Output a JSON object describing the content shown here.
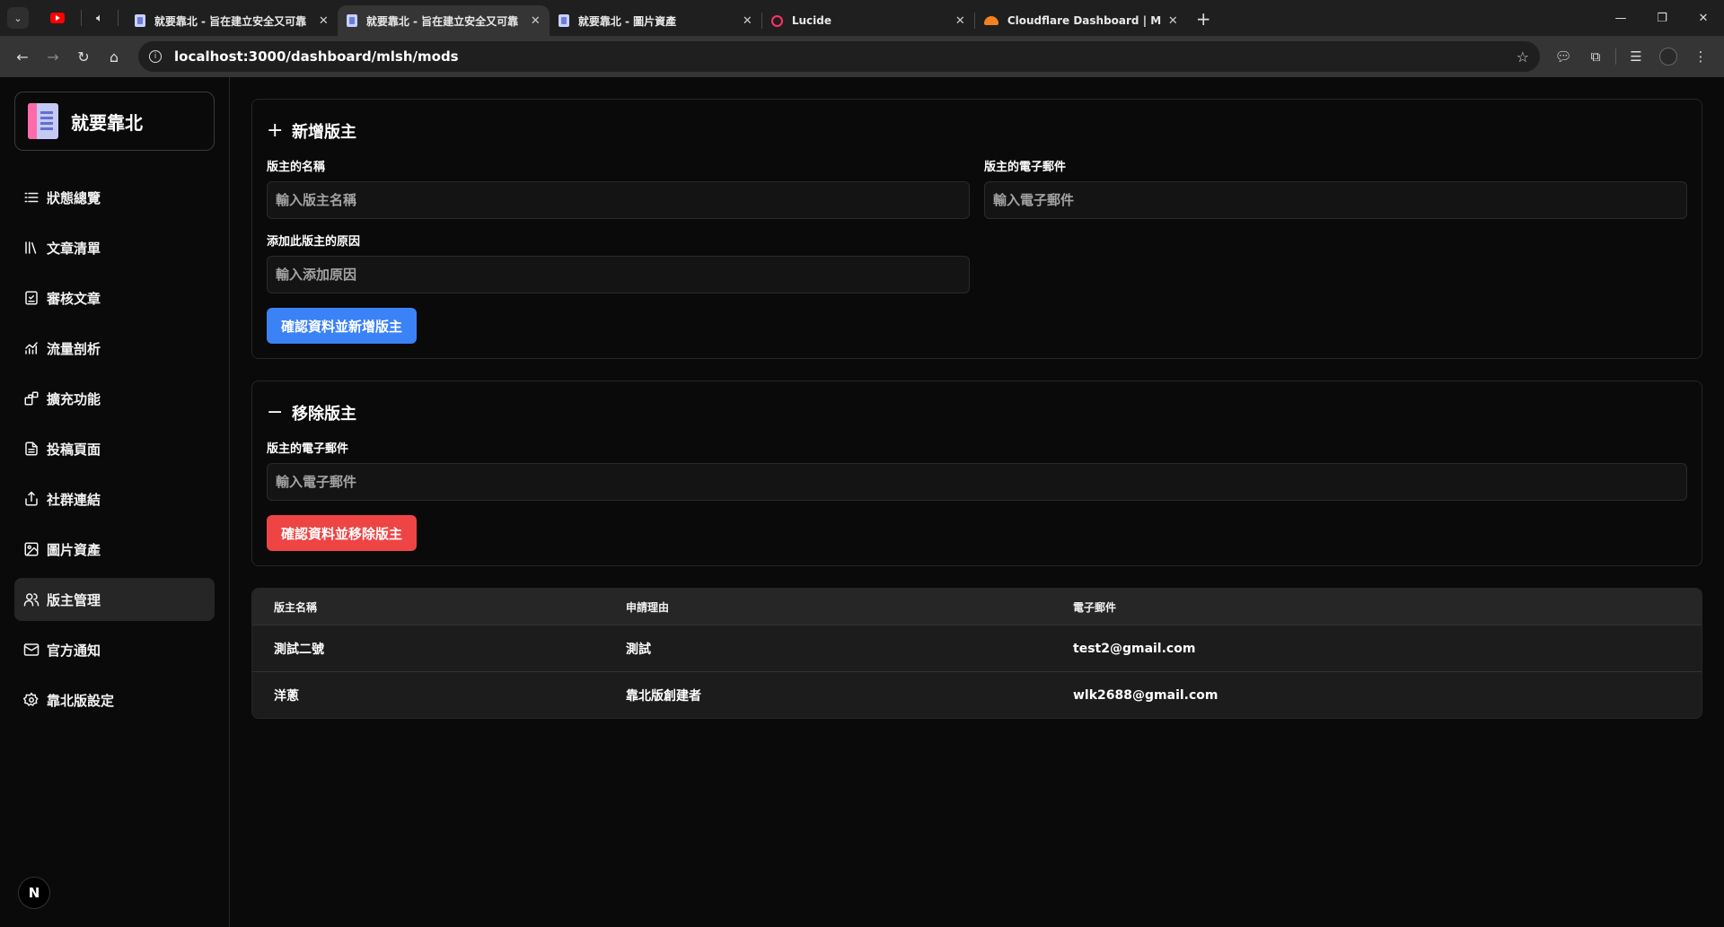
{
  "browser": {
    "tabs": [
      {
        "title": "就要靠北 - 旨在建立安全又可靠",
        "favicon": "app-icon",
        "active": false
      },
      {
        "title": "就要靠北 - 旨在建立安全又可靠",
        "favicon": "app-icon",
        "active": true
      },
      {
        "title": "就要靠北 - 圖片資產",
        "favicon": "app-icon",
        "active": false
      },
      {
        "title": "Lucide",
        "favicon": "lucide-icon",
        "active": false
      },
      {
        "title": "Cloudflare Dashboard | Ma",
        "favicon": "cloudflare-icon",
        "active": false
      }
    ],
    "url": "localhost:3000/dashboard/mlsh/mods"
  },
  "sidebar": {
    "brand": "就要靠北",
    "items": [
      {
        "label": "狀態總覽",
        "icon": "list-icon"
      },
      {
        "label": "文章清單",
        "icon": "library-icon"
      },
      {
        "label": "審核文章",
        "icon": "check-square-icon"
      },
      {
        "label": "流量剖析",
        "icon": "chart-icon"
      },
      {
        "label": "擴充功能",
        "icon": "blocks-icon"
      },
      {
        "label": "投稿頁面",
        "icon": "file-text-icon"
      },
      {
        "label": "社群連結",
        "icon": "share-icon"
      },
      {
        "label": "圖片資產",
        "icon": "image-icon"
      },
      {
        "label": "版主管理",
        "icon": "users-icon",
        "active": true
      },
      {
        "label": "官方通知",
        "icon": "mail-icon"
      },
      {
        "label": "靠北版設定",
        "icon": "settings-icon"
      }
    ],
    "badge": "N"
  },
  "add_mod": {
    "title": "新增版主",
    "name_label": "版主的名稱",
    "name_placeholder": "輸入版主名稱",
    "email_label": "版主的電子郵件",
    "email_placeholder": "輸入電子郵件",
    "reason_label": "添加此版主的原因",
    "reason_placeholder": "輸入添加原因",
    "submit": "確認資料並新增版主"
  },
  "remove_mod": {
    "title": "移除版主",
    "email_label": "版主的電子郵件",
    "email_placeholder": "輸入電子郵件",
    "submit": "確認資料並移除版主"
  },
  "table": {
    "headers": [
      "版主名稱",
      "申請理由",
      "電子郵件"
    ],
    "rows": [
      [
        "測試二號",
        "測試",
        "test2@gmail.com"
      ],
      [
        "洋蔥",
        "靠北版創建者",
        "wlk2688@gmail.com"
      ]
    ]
  },
  "colors": {
    "primary": "#3b82f6",
    "danger": "#ef4444",
    "background": "#0a0a0a"
  }
}
